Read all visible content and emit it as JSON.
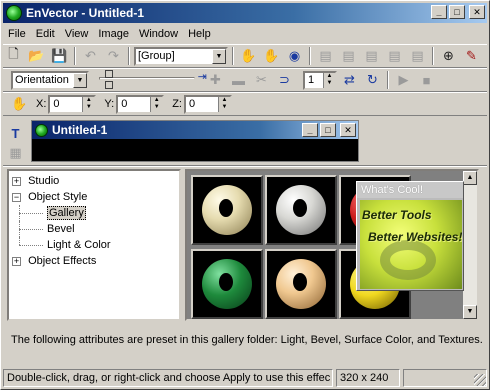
{
  "window": {
    "title": "EnVector - Untitled-1",
    "controls": {
      "minimize": "_",
      "maximize": "□",
      "close": "✕"
    }
  },
  "menu": [
    "File",
    "Edit",
    "View",
    "Image",
    "Window",
    "Help"
  ],
  "toolbar1": {
    "group_combo": "[Group]",
    "icons": [
      "new-icon",
      "open-icon",
      "save-icon",
      "undo-icon",
      "redo-icon",
      "hand-icon",
      "rotate-hand-icon",
      "select-target-icon",
      "layer1-icon",
      "layer2-icon",
      "layer3-icon",
      "layer4-icon",
      "layer5-icon",
      "globe-icon",
      "edit-icon"
    ]
  },
  "toolbar2": {
    "orientation_combo": "Orientation",
    "frame_value": "1"
  },
  "toolbar3": {
    "x_label": "X:",
    "x_value": "0",
    "y_label": "Y:",
    "y_value": "0",
    "z_label": "Z:",
    "z_value": "0"
  },
  "child_window": {
    "title": "Untitled-1"
  },
  "tree": {
    "items": [
      {
        "label": "Studio",
        "expander": "+",
        "level": 0
      },
      {
        "label": "Object Style",
        "expander": "−",
        "level": 0
      },
      {
        "label": "Gallery",
        "expander": "",
        "level": 1,
        "selected": true
      },
      {
        "label": "Bevel",
        "expander": "",
        "level": 1
      },
      {
        "label": "Light & Color",
        "expander": "",
        "level": 1
      },
      {
        "label": "Object Effects",
        "expander": "+",
        "level": 0
      }
    ]
  },
  "gallery": {
    "thumbs": [
      {
        "name": "cream-torus",
        "color": "#e6dcb0"
      },
      {
        "name": "white-torus",
        "color": "#d8d8d4"
      },
      {
        "name": "red-torus",
        "color": "#cc1e1e"
      },
      {
        "name": "green-torus",
        "color": "#1e8a3c"
      },
      {
        "name": "peach-torus",
        "color": "#f0c890"
      },
      {
        "name": "yellow-torus",
        "color": "#f0d820"
      }
    ]
  },
  "popup": {
    "title": "What's Cool!",
    "line1": "Better Tools",
    "line2": "Better Websites!"
  },
  "info_text": "The following attributes are preset in this gallery folder: Light, Bevel, Surface Color, and Textures.",
  "status": {
    "hint": "Double-click, drag, or right-click and choose Apply to use this effec",
    "size": "320 x 240",
    "extra": ""
  }
}
